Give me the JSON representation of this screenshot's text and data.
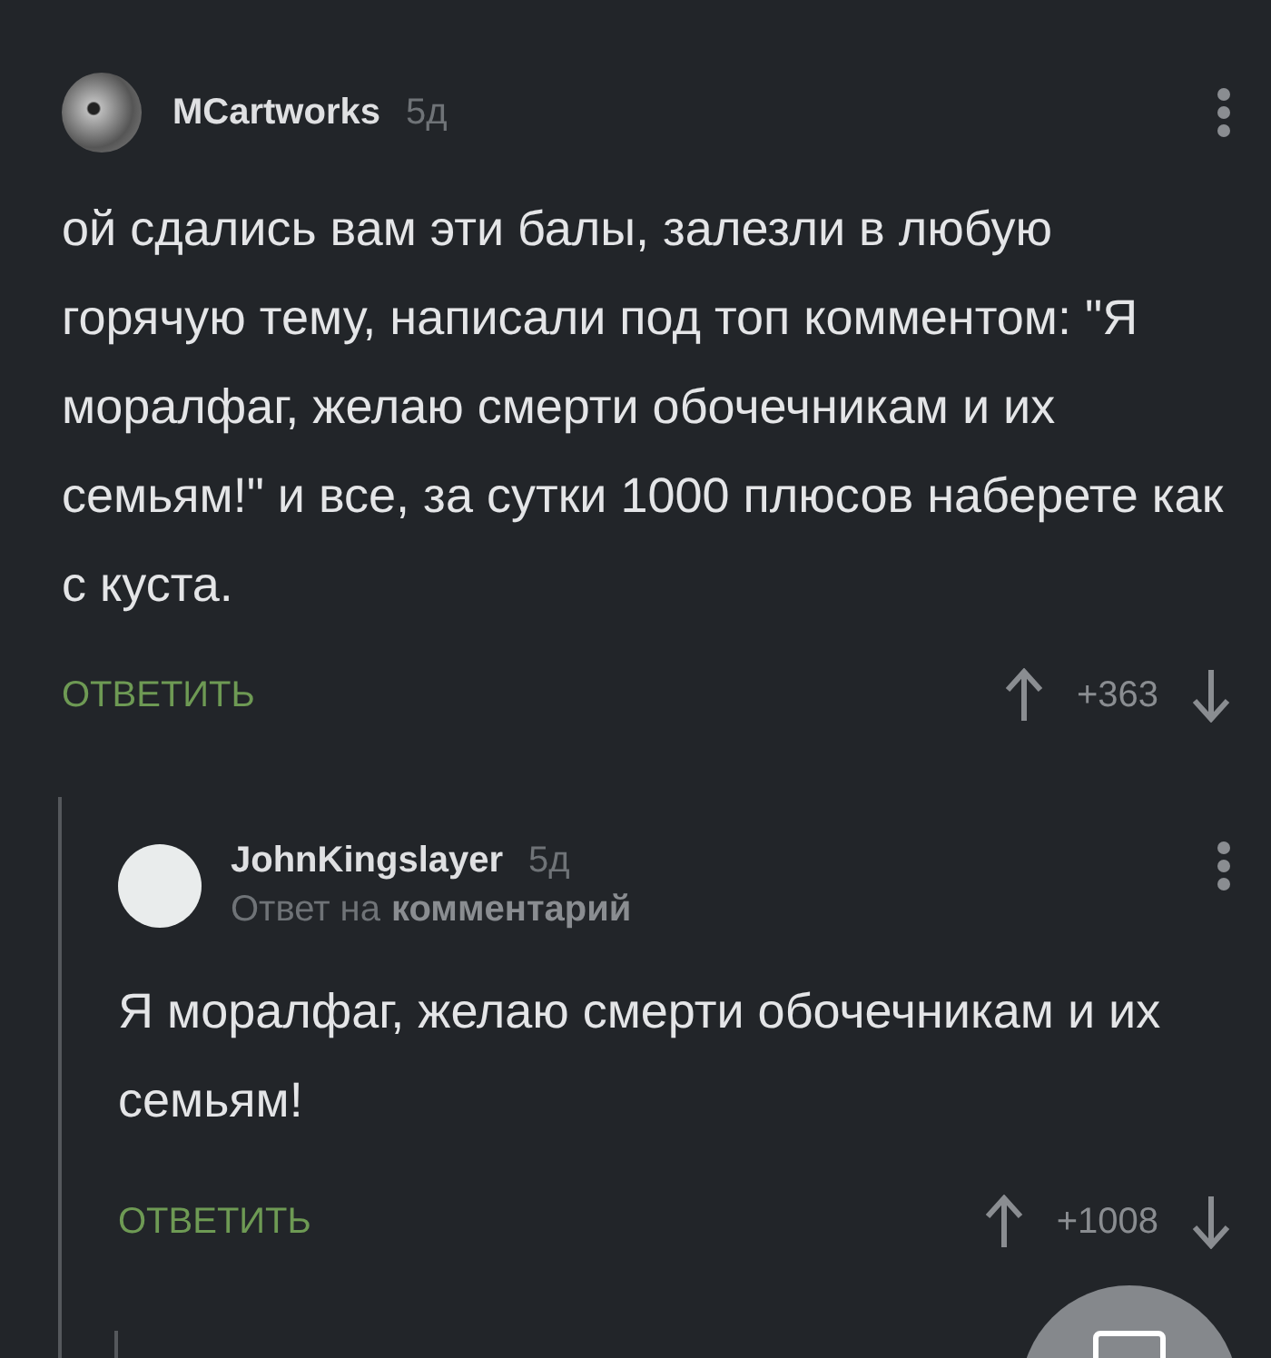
{
  "comment": {
    "author": "MCartworks",
    "age": "5д",
    "text": "ой сдались вам эти балы, залезли в любую горячую тему, написали под топ комментом: \"Я моралфаг, желаю смерти обочечникам и их семьям!\" и все, за сутки 1000 плюсов наберете как с куста.",
    "reply_label": "ОТВЕТИТЬ",
    "score": "+363",
    "reply": {
      "author": "JohnKingslayer",
      "age": "5д",
      "reply_to": "Ответ на",
      "reply_to_link": "комментарий",
      "text": "Я моралфаг, желаю смерти обочечникам и их семьям!",
      "reply_label": "ОТВЕТИТЬ",
      "score": "+1008"
    }
  }
}
